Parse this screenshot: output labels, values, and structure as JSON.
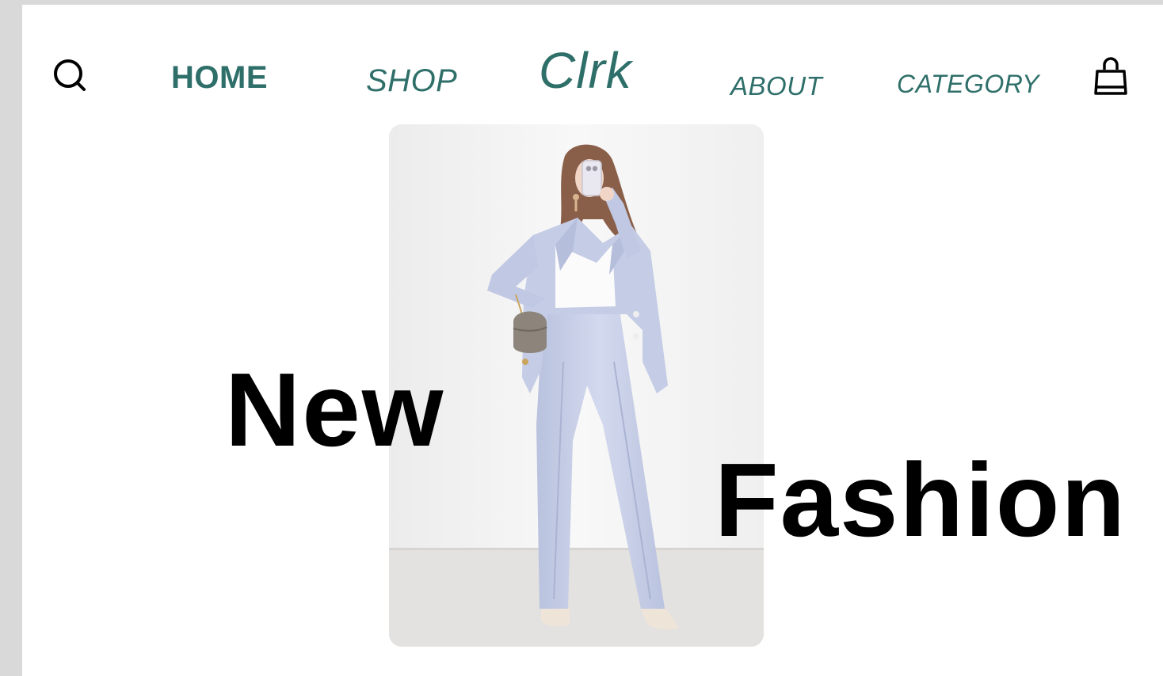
{
  "nav": {
    "home_label": "HOME",
    "shop_label": "SHOP",
    "about_label": "ABOUT",
    "category_label": "CATEGORY",
    "search_icon": "search-icon",
    "cart_icon": "shopping-bag-icon"
  },
  "brand": {
    "logo_text": "Clrk",
    "color": "#2f6f6a"
  },
  "hero": {
    "headline_word_1": "New",
    "headline_word_2": "Fashion",
    "photo_icon": "fashion-model-photo"
  },
  "colors": {
    "accent": "#2f6f6a",
    "headline": "#000000",
    "background": "#ffffff",
    "suit": "#c9d1ea"
  }
}
